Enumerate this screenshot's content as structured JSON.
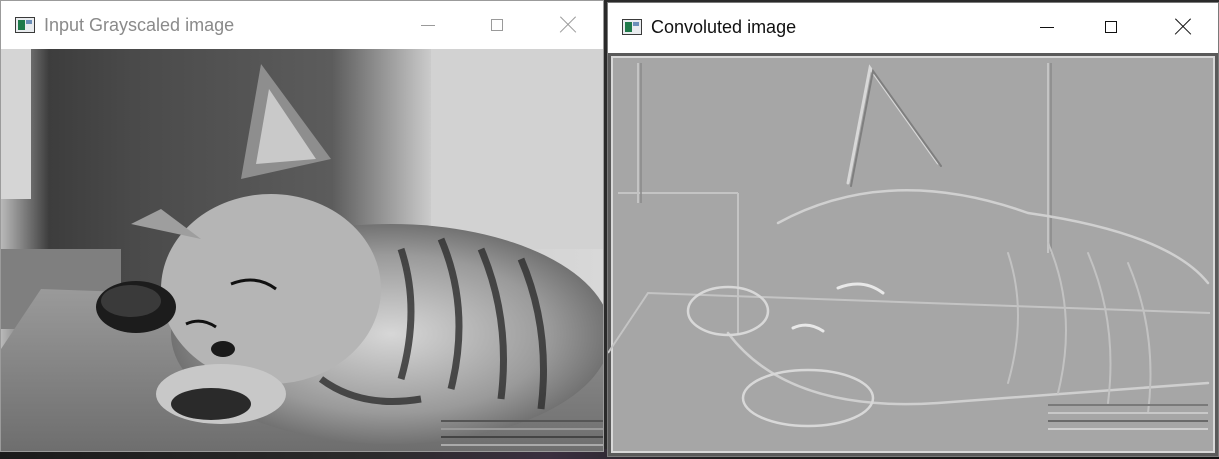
{
  "windows": [
    {
      "title": "Input Grayscaled image",
      "state": "inactive",
      "icon": "app-image-icon",
      "controls": [
        "minimize-icon",
        "maximize-icon",
        "close-icon"
      ]
    },
    {
      "title": "Convoluted image",
      "state": "active",
      "icon": "app-image-icon",
      "controls": [
        "minimize-icon",
        "maximize-icon",
        "close-icon"
      ]
    }
  ],
  "colors": {
    "grayscale_background": "#8c8c8c",
    "convolved_background": "#a6a6a6",
    "taskbar": "#1e1e1e"
  }
}
